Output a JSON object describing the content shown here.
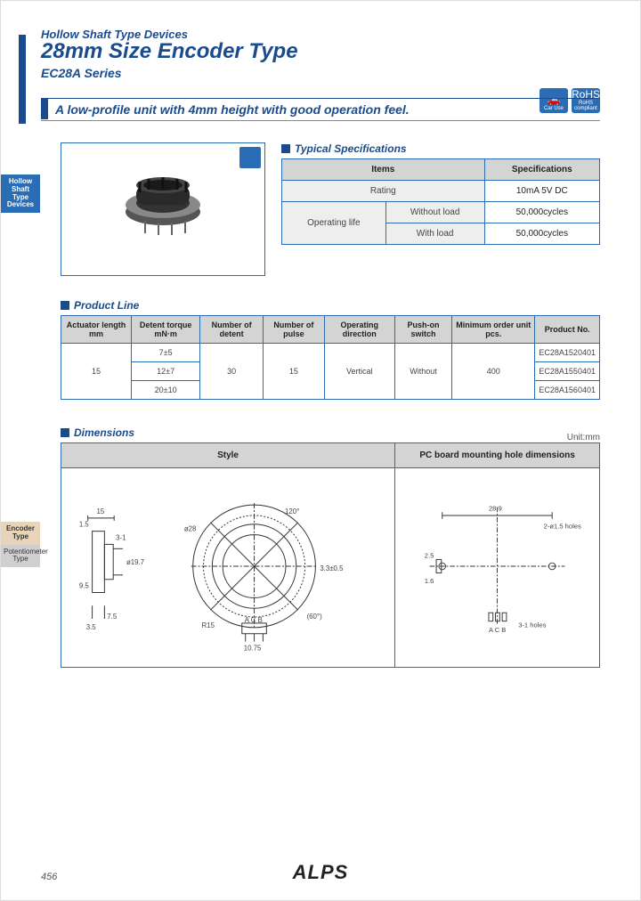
{
  "header": {
    "subtitle": "Hollow Shaft Type Devices",
    "title": "28mm Size Encoder Type",
    "series": "EC28A Series"
  },
  "badges": {
    "car": "Car Use",
    "rohs": "RoHS compliant"
  },
  "tagline": "A low-profile unit with 4mm height with good operation feel.",
  "sidetabs": {
    "hollow": "Hollow Shaft Type Devices",
    "encoder": "Encoder Type",
    "pot": "Potentiometer Type"
  },
  "spec": {
    "title": "Typical Specifications",
    "headers": {
      "items": "Items",
      "spec": "Specifications"
    },
    "rows": {
      "rating": {
        "label": "Rating",
        "value": "10mA 5V DC"
      },
      "oplife": {
        "label": "Operating life",
        "without_label": "Without load",
        "without_value": "50,000cycles",
        "with_label": "With load",
        "with_value": "50,000cycles"
      }
    }
  },
  "prodline": {
    "title": "Product Line",
    "headers": {
      "actuator": "Actuator length mm",
      "torque": "Detent torque mN·m",
      "ndetent": "Number of detent",
      "npulse": "Number of pulse",
      "opdir": "Operating direction",
      "pushon": "Push-on switch",
      "minorder": "Minimum order unit pcs.",
      "prodno": "Product No."
    },
    "data": {
      "actuator": "15",
      "torque1": "7±5",
      "torque2": "12±7",
      "torque3": "20±10",
      "ndetent": "30",
      "npulse": "15",
      "opdir": "Vertical",
      "pushon": "Without",
      "minorder": "400",
      "pn1": "EC28A1520401",
      "pn2": "EC28A1550401",
      "pn3": "EC28A1560401"
    }
  },
  "dimensions": {
    "title": "Dimensions",
    "unit": "Unit:mm",
    "headers": {
      "style": "Style",
      "pcb": "PC board mounting hole dimensions"
    },
    "callouts": {
      "d15": "15",
      "d1_5": "1.5",
      "d3_1": "3-1",
      "d3_5": "3.5",
      "d7_5": "7.5",
      "d9_5": "9.5",
      "phi28": "ø28",
      "phi19_7": "ø19.7",
      "r15": "R15",
      "deg60": "(60°)",
      "deg120": "120°",
      "d10_75": "10.75",
      "acb": "A C B",
      "d28_9": "28.9",
      "d2_5": "2.5",
      "d1_6": "1.6",
      "holes_a": "2-ø1.5 holes",
      "holes_b": "3-1 holes",
      "d3_3": "3.3±0.5"
    }
  },
  "footer": {
    "brand": "ALPS",
    "page": "456"
  }
}
